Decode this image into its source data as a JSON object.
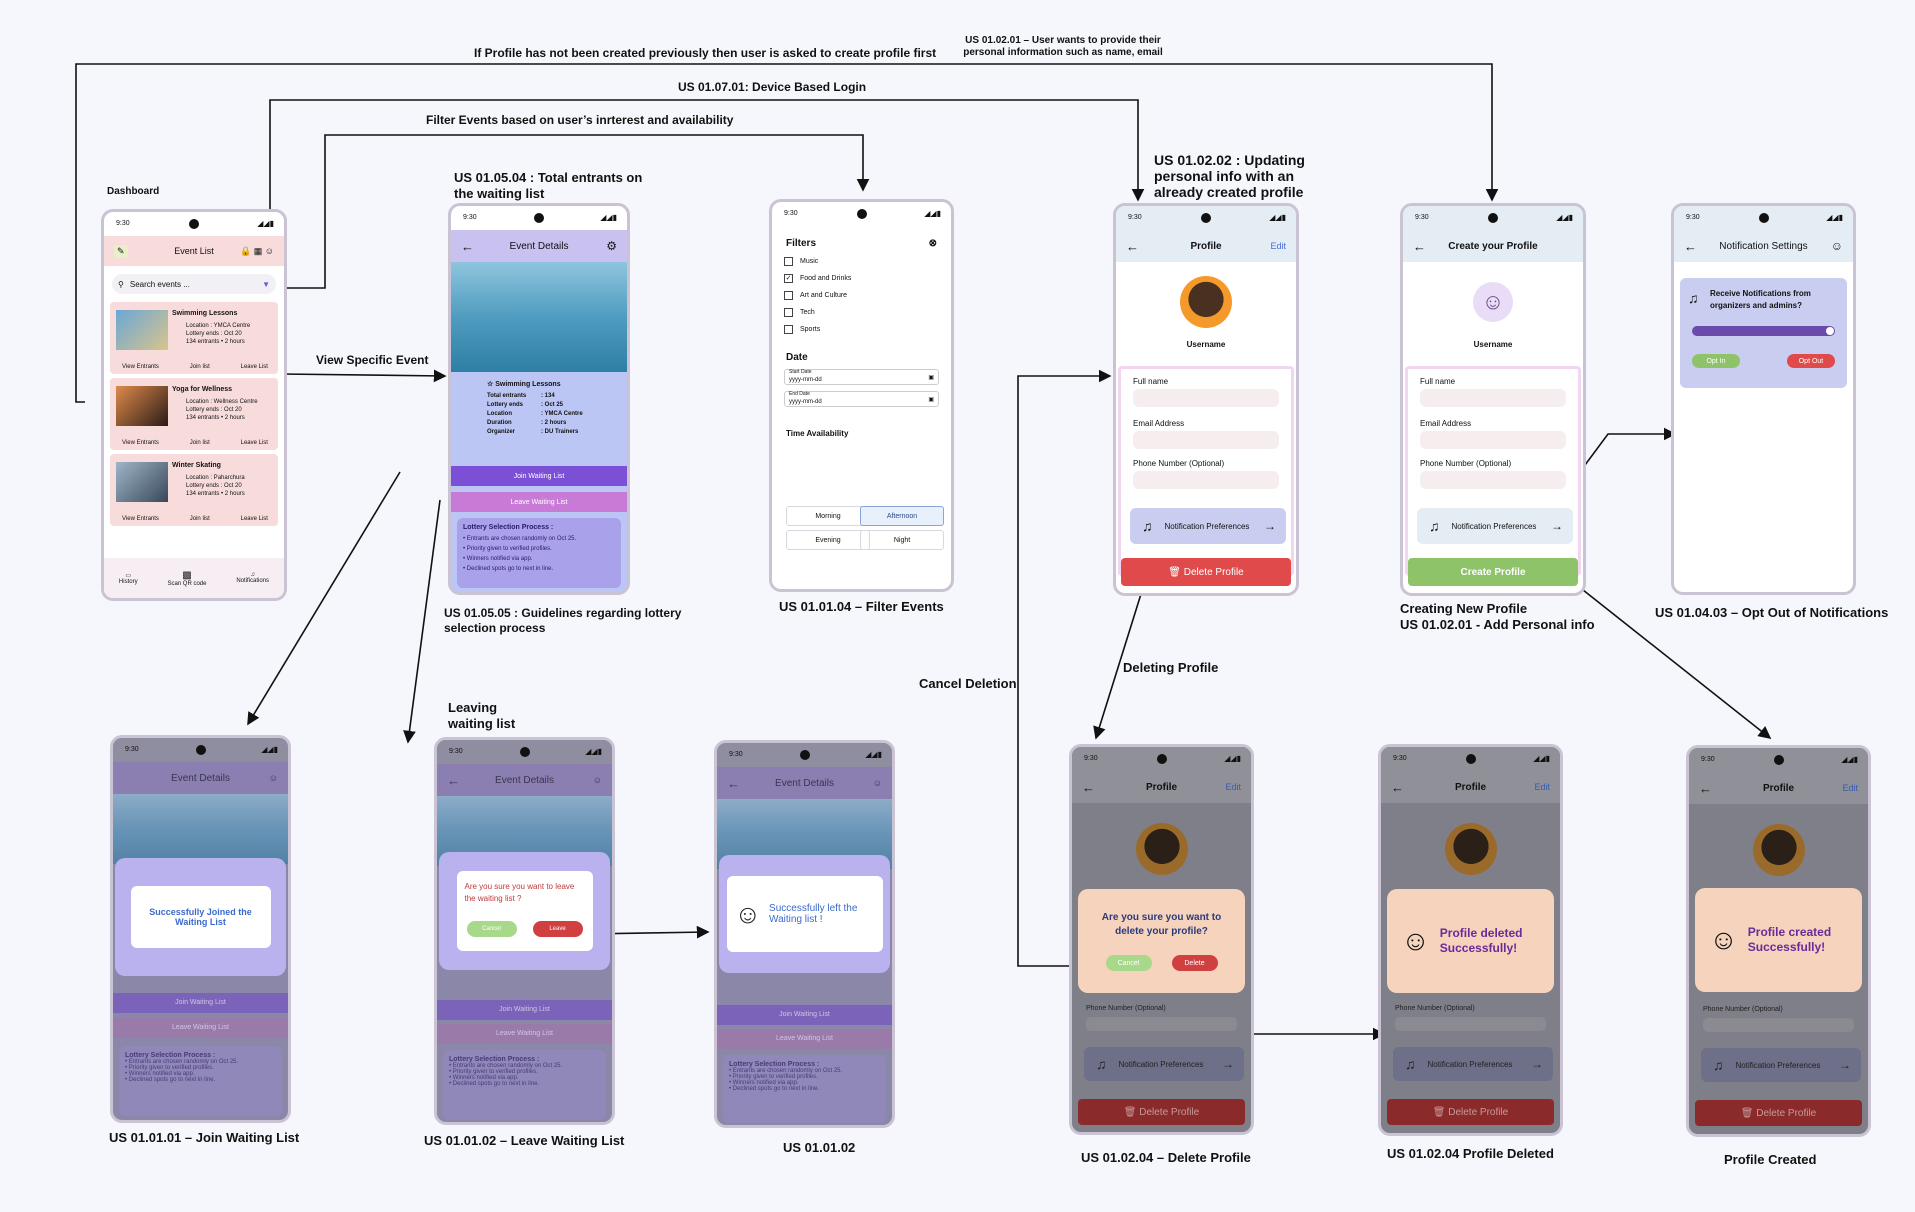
{
  "labels": {
    "us010201_note": "US 01.02.01 – User wants to provide their personal information such as name, email",
    "profile_first": "If Profile has not been created previously then user is asked to create profile first",
    "device_login": "US 01.07.01: Device Based Login",
    "filter_note": "Filter Events based on user’s inrterest and availability",
    "dashboard": "Dashboard",
    "total_entrants": "US 01.05.04 : Total entrants on the waiting list",
    "updating": "US 01.02.02 : Updating personal info with an already created profile",
    "view_specific": "View Specific Event",
    "guidelines": "US 01.05.05 : Guidelines regarding lottery selection process",
    "filter_events": "US 01.01.04 – Filter Events",
    "creating_new": "Creating New Profile",
    "add_personal": "US 01.02.01 - Add Personal info",
    "opt_out": "US 01.04.03 – Opt Out of Notifications",
    "deleting_profile": "Deleting Profile",
    "cancel_deletion": "Cancel Deletion",
    "leaving": "Leaving waiting list",
    "join_cap": "US 01.01.01 – Join Waiting List",
    "leave_cap": "US 01.01.02 – Leave Waiting List",
    "us010102": "US 01.01.02",
    "delete_cap": "US 01.02.04 – Delete Profile",
    "deleted_cap": "US 01.02.04 Profile Deleted",
    "created_cap": "Profile Created"
  },
  "status_time": "9:30",
  "event_list": {
    "title": "Event List",
    "search_placeholder": "Search events ...",
    "events": [
      {
        "name": "Swimming Lessons",
        "location": "Location : YMCA Centre",
        "lottery": "Lottery ends : Oct 20",
        "entrants": "134 entrants  • 2 hours"
      },
      {
        "name": "Yoga for Wellness",
        "location": "Location : Wellness Centre",
        "lottery": "Lottery ends : Oct 20",
        "entrants": "134 entrants  • 2 hours"
      },
      {
        "name": "Winter Skating",
        "location": "Location : Paharchura",
        "lottery": "Lottery ends : Oct 20",
        "entrants": "134 entrants  • 2 hours"
      }
    ],
    "actions": [
      "View Entrants",
      "Join list",
      "Leave List"
    ],
    "nav": [
      "History",
      "Scan QR code",
      "Notifications"
    ]
  },
  "event_details": {
    "title": "Event Details",
    "name": "Swimming Lessons",
    "rows": [
      [
        "Total entrants",
        ": 134"
      ],
      [
        "Lottery ends",
        ": Oct 25"
      ],
      [
        "Location",
        ": YMCA Centre"
      ],
      [
        "Duration",
        ": 2 hours"
      ],
      [
        "Organizer",
        ": DU Trainers"
      ]
    ],
    "join": "Join Waiting List",
    "leave": "Leave Waiting List",
    "lottery_title": "Lottery Selection Process :",
    "lottery_items": [
      "Entrants are chosen randomly on Oct 25.",
      "Priority given to verified profiles.",
      "Winners notified via app.",
      "Declined spots go to next in line."
    ]
  },
  "filters": {
    "title": "Filters",
    "options": [
      "Music",
      "Food and Drinks",
      "Art and Culture",
      "Tech",
      "Sports"
    ],
    "checked": "Food and Drinks",
    "date_title": "Date",
    "start": "Start Date",
    "end": "End Date",
    "date_ph": "yyyy-mm-dd",
    "time_title": "Time Availability",
    "times": [
      "Morning",
      "Afternoon",
      "Evening",
      "Night"
    ]
  },
  "profile": {
    "title": "Profile",
    "edit": "Edit",
    "username": "Username",
    "full_name": "Full name",
    "email": "Email Address",
    "phone": "Phone Number (Optional)",
    "notif": "Notification Preferences",
    "delete": "Delete Profile"
  },
  "create_profile": {
    "title": "Create your Profile",
    "button": "Create Profile"
  },
  "notif_settings": {
    "title": "Notification Settings",
    "question": "Receive Notifications from organizers and admins?",
    "opt_in": "Opt In",
    "opt_out": "Opt Out"
  },
  "dialogs": {
    "joined": "Successfully Joined the Waiting List",
    "leave_q": "Are you sure you want to leave the waiting list ?",
    "cancel": "Cancel",
    "leave": "Leave",
    "left": "Successfully left the Waiting list !",
    "delete_q": "Are you sure you want to delete your profile?",
    "delete": "Delete",
    "deleted": "Profile deleted Successfully!",
    "created": "Profile created Successfully!"
  },
  "colors": {
    "purple": "#7b4fd6",
    "pink": "#f8dcdc",
    "red": "#e04a4a",
    "green": "#8ec36a",
    "lavender": "#c9c2f0",
    "peach": "#f5d3bd"
  }
}
